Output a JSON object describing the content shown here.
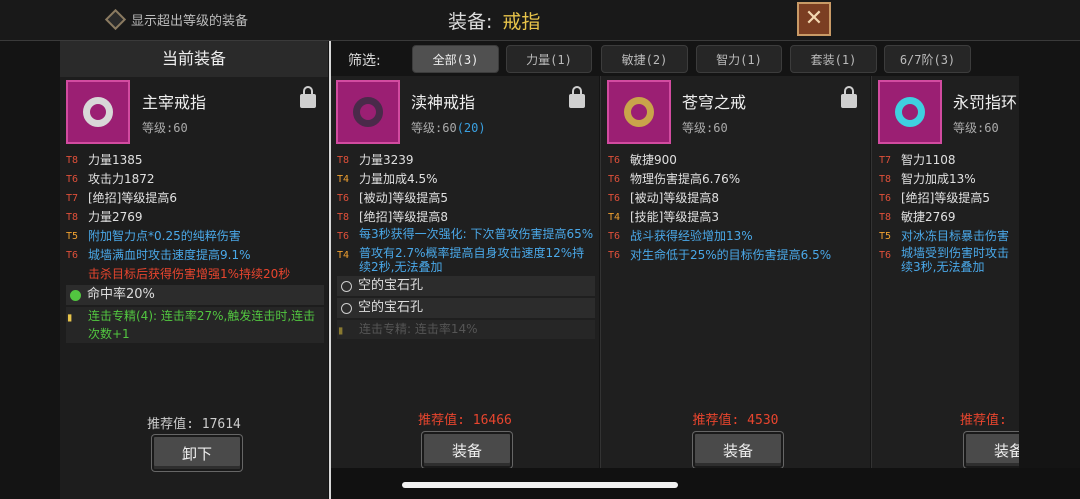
{
  "topbar": {
    "show_overlevel_label": "显示超出等级的装备",
    "title_prefix": "装备:",
    "title_highlight": "戒指"
  },
  "colors": {
    "accent_gold": "#e8c44a",
    "icon_bg": "#9b1f73",
    "stat_red": "#e8452e",
    "stat_blue": "#4aa8e8",
    "stat_green": "#52c640"
  },
  "left_panel": {
    "header": "当前装备"
  },
  "filter": {
    "label": "筛选:",
    "chips": [
      "全部(3)",
      "力量(1)",
      "敏捷(2)",
      "智力(1)",
      "套装(1)",
      "6/7阶(3)"
    ]
  },
  "current": {
    "name": "主宰戒指",
    "level": "等级:60",
    "stats": [
      {
        "tier": "T8",
        "text": "力量1385"
      },
      {
        "tier": "T6",
        "text": "攻击力1872"
      },
      {
        "tier": "T7",
        "text": "[绝招]等级提高6"
      },
      {
        "tier": "T8",
        "text": "力量2769"
      },
      {
        "tier": "T5",
        "text": "附加智力点*0.25的纯粹伤害"
      },
      {
        "tier": "T6",
        "text": "城墙满血时攻击速度提高9.1%"
      }
    ],
    "red_line": "击杀目标后获得伤害增强1%持续20秒",
    "gem_line": "命中率20%",
    "set_line": "连击专精(4): 连击率27%,触发连击时,连击次数+1",
    "recommend": "推荐值: 17614",
    "button": "卸下"
  },
  "cards": [
    {
      "name": "渎神戒指",
      "level": "等级:60",
      "level_extra": "(20)",
      "stats": [
        {
          "tier": "T8",
          "text": "力量3239"
        },
        {
          "tier": "T4",
          "text": "力量加成4.5%"
        },
        {
          "tier": "T6",
          "text": "[被动]等级提高5"
        },
        {
          "tier": "T8",
          "text": "[绝招]等级提高8"
        },
        {
          "tier": "T6",
          "text": "每3秒获得一次强化: 下次普攻伤害提高65%"
        },
        {
          "tier": "T4",
          "text": "普攻有2.7%概率提高自身攻击速度12%持续2秒,无法叠加"
        }
      ],
      "slot1": "空的宝石孔",
      "slot2": "空的宝石孔",
      "set_line": "连击专精: 连击率14%",
      "recommend": "推荐值: 16466",
      "button": "装备"
    },
    {
      "name": "苍穹之戒",
      "level": "等级:60",
      "stats": [
        {
          "tier": "T6",
          "text": "敏捷900"
        },
        {
          "tier": "T6",
          "text": "物理伤害提高6.76%"
        },
        {
          "tier": "T6",
          "text": "[被动]等级提高8"
        },
        {
          "tier": "T4",
          "text": "[技能]等级提高3"
        },
        {
          "tier": "T6",
          "text": "战斗获得经验增加13%"
        },
        {
          "tier": "T6",
          "text": "对生命低于25%的目标伤害提高6.5%"
        }
      ],
      "recommend": "推荐值: 4530",
      "button": "装备"
    },
    {
      "name": "永罚指环",
      "level": "等级:60",
      "stats": [
        {
          "tier": "T7",
          "text": "智力1108"
        },
        {
          "tier": "T8",
          "text": "智力加成13%"
        },
        {
          "tier": "T6",
          "text": "[绝招]等级提高5"
        },
        {
          "tier": "T8",
          "text": "敏捷2769"
        },
        {
          "tier": "T5",
          "text": "对冰冻目标暴击伤害"
        },
        {
          "tier": "T6",
          "text": "城墙受到伤害时攻击续3秒,无法叠加"
        }
      ],
      "recommend": "推荐值:",
      "button": "装备"
    }
  ]
}
